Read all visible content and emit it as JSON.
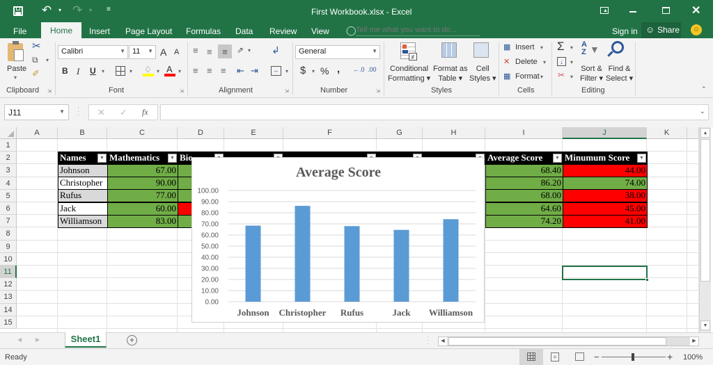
{
  "window": {
    "title": "First Workbook.xlsx - Excel",
    "qat": {
      "save": "save-icon",
      "undo": "undo-icon",
      "redo": "redo-icon",
      "customize": "customize-qat-icon"
    },
    "controls": {
      "ribbon_display": "ribbon-display-icon",
      "minimize": "minimize-icon",
      "maximize": "maximize-icon",
      "close": "close-icon"
    }
  },
  "tabs": [
    "File",
    "Home",
    "Insert",
    "Page Layout",
    "Formulas",
    "Data",
    "Review",
    "View"
  ],
  "active_tab": "Home",
  "tell_me": {
    "placeholder": "Tell me what you want to do..."
  },
  "account": {
    "sign_in": "Sign in",
    "share": "Share"
  },
  "ribbon": {
    "clipboard": {
      "label": "Clipboard",
      "paste": "Paste"
    },
    "font": {
      "label": "Font",
      "name": "Calibri",
      "size": "11",
      "bold": "B",
      "italic": "I",
      "underline": "U",
      "grow": "A",
      "shrink": "A",
      "font_color": "A"
    },
    "alignment": {
      "label": "Alignment"
    },
    "number": {
      "label": "Number",
      "format": "General",
      "currency": "$",
      "percent": "%",
      "comma": ","
    },
    "styles": {
      "label": "Styles",
      "conditional": [
        "Conditional",
        "Formatting"
      ],
      "format_table": [
        "Format as",
        "Table"
      ],
      "cell_styles": [
        "Cell",
        "Styles"
      ]
    },
    "cells": {
      "label": "Cells",
      "insert": "Insert",
      "delete": "Delete",
      "format": "Format"
    },
    "editing": {
      "label": "Editing",
      "sort": [
        "Sort &",
        "Filter"
      ],
      "find": [
        "Find &",
        "Select"
      ]
    }
  },
  "formula_bar": {
    "name_box": "J11",
    "cancel": "✕",
    "enter": "✓",
    "fx": "fx",
    "formula": ""
  },
  "columns": [
    "A",
    "B",
    "C",
    "D",
    "E",
    "F",
    "G",
    "H",
    "I",
    "J",
    "K"
  ],
  "selected_column": "J",
  "rows": [
    "1",
    "2",
    "3",
    "4",
    "5",
    "6",
    "7",
    "8",
    "9",
    "10",
    "11",
    "12",
    "13",
    "14",
    "15"
  ],
  "selected_row": "11",
  "selected_cell": "J11",
  "table": {
    "headers": {
      "names": "Names",
      "math": "Mathematics",
      "bio": "Bio",
      "avg": "Average Score",
      "min": "Minumum Score"
    },
    "rows": [
      {
        "name": "Johnson",
        "math": "67.00",
        "bio_fill": "green",
        "avg": "68.40",
        "min": "44.00",
        "min_fill": "red"
      },
      {
        "name": "Christopher",
        "math": "90.00",
        "bio_fill": "green",
        "avg": "86.20",
        "min": "74.00",
        "min_fill": "green"
      },
      {
        "name": "Rufus",
        "math": "77.00",
        "bio_fill": "green",
        "avg": "68.00",
        "min": "38.00",
        "min_fill": "red"
      },
      {
        "name": "Jack",
        "math": "60.00",
        "bio_fill": "red",
        "avg": "64.60",
        "min": "45.00",
        "min_fill": "red"
      },
      {
        "name": "Williamson",
        "math": "83.00",
        "bio_fill": "green",
        "avg": "74.20",
        "min": "41.00",
        "min_fill": "red"
      }
    ],
    "colors": {
      "green": "#70ad47",
      "red": "#ff0000",
      "header": "#000000",
      "name_shade": "#d9d9d9"
    }
  },
  "chart_data": {
    "type": "bar",
    "title": "Average Score",
    "categories": [
      "Johnson",
      "Christopher",
      "Rufus",
      "Jack",
      "Williamson"
    ],
    "values": [
      68.4,
      86.2,
      68.0,
      64.6,
      74.2
    ],
    "ylim": [
      0,
      100
    ],
    "yticks": [
      "0.00",
      "10.00",
      "20.00",
      "30.00",
      "40.00",
      "50.00",
      "60.00",
      "70.00",
      "80.00",
      "90.00",
      "100.00"
    ],
    "xlabel": "",
    "ylabel": "",
    "grid": true,
    "legend": "none",
    "bar_color": "#5b9bd5"
  },
  "sheets": [
    "Sheet1"
  ],
  "active_sheet": "Sheet1",
  "status": {
    "text": "Ready",
    "zoom": "100%",
    "zoom_minus": "−",
    "zoom_plus": "+"
  }
}
